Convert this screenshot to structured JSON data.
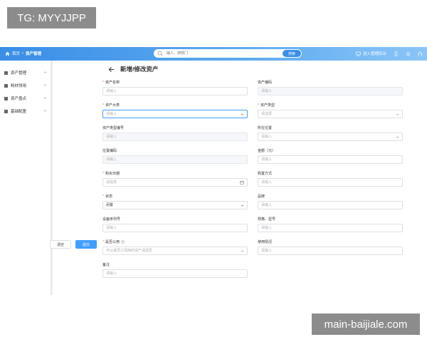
{
  "watermarks": {
    "top": "TG: MYYJJPP",
    "bottom": "main-baijiale.com"
  },
  "topbar": {
    "breadcrumb": {
      "home": "首页",
      "sep": "›",
      "current": "资产管理"
    },
    "search": {
      "placeholder": "输人、搜部门",
      "button": "搜索"
    },
    "manage_label": "进入管理后台"
  },
  "sidebar": {
    "items": [
      {
        "label": "资产管理"
      },
      {
        "label": "耗材领用"
      },
      {
        "label": "资产盘点"
      },
      {
        "label": "基础配置"
      }
    ]
  },
  "page": {
    "title": "新增/修改资产"
  },
  "form": {
    "asset_name": {
      "label": "资产名称",
      "placeholder": "请输入",
      "required": true
    },
    "asset_code": {
      "label": "资产编码",
      "placeholder": "请输入",
      "required": false
    },
    "asset_category": {
      "label": "资产大类",
      "placeholder": "请输入",
      "required": true
    },
    "asset_type": {
      "label": "资产类型",
      "placeholder": "请选择",
      "required": true
    },
    "asset_type_code": {
      "label": "资产类型编号",
      "placeholder": "请输入",
      "required": false
    },
    "location": {
      "label": "所在位置",
      "placeholder": "请输入",
      "required": false
    },
    "location_code": {
      "label": "位置编码",
      "placeholder": "请输入",
      "required": false
    },
    "amount": {
      "label": "金额（元）",
      "placeholder": "请输入",
      "required": false
    },
    "purchase_date": {
      "label": "购买日期",
      "placeholder": "请选择",
      "required": true
    },
    "purchase_method": {
      "label": "购置方式",
      "placeholder": "请输入",
      "required": false
    },
    "status": {
      "label": "状态",
      "value": "闲置",
      "required": true
    },
    "brand": {
      "label": "品牌",
      "placeholder": "请输入",
      "required": false
    },
    "serial_no": {
      "label": "设备序列号",
      "placeholder": "请输入",
      "required": false
    },
    "spec_model": {
      "label": "规格、型号",
      "placeholder": "请输入",
      "required": false
    },
    "is_public": {
      "label": "是否公用",
      "placeholder": "可以被员工领用的资产请选否",
      "required": true
    },
    "usage": {
      "label": "使用情况",
      "placeholder": "请输入",
      "required": false
    },
    "remark": {
      "label": "备注",
      "placeholder": "请输入",
      "required": false
    }
  },
  "actions": {
    "clear": "清空",
    "submit": "提交"
  }
}
